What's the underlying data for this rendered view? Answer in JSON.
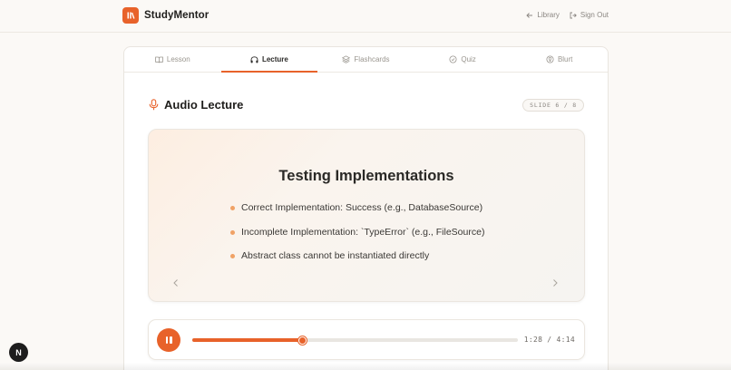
{
  "brand": {
    "name": "StudyMentor",
    "logo_text": "ln"
  },
  "topnav": {
    "library": "Library",
    "signout": "Sign Out"
  },
  "tabs": [
    {
      "label": "Lesson",
      "icon": "book-icon",
      "active": false
    },
    {
      "label": "Lecture",
      "icon": "headphones-icon",
      "active": true
    },
    {
      "label": "Flashcards",
      "icon": "layers-icon",
      "active": false
    },
    {
      "label": "Quiz",
      "icon": "clock-check-icon",
      "active": false
    },
    {
      "label": "Blurt",
      "icon": "lightbulb-icon",
      "active": false
    }
  ],
  "section": {
    "title": "Audio Lecture",
    "icon": "microphone-icon",
    "slide_badge": "SLIDE 6 / 8"
  },
  "slide": {
    "heading": "Testing Implementations",
    "bullets": [
      "Correct Implementation: Success (e.g., DatabaseSource)",
      "Incomplete Implementation: `TypeError` (e.g., FileSource)",
      "Abstract class cannot be instantiated directly"
    ]
  },
  "player": {
    "state": "playing",
    "time": "1:28 / 4:14",
    "progress": 0.338
  },
  "dev_badge": "N",
  "colors": {
    "accent": "#e8622a",
    "bullet": "#f0a266",
    "background": "#fbf9f6"
  }
}
